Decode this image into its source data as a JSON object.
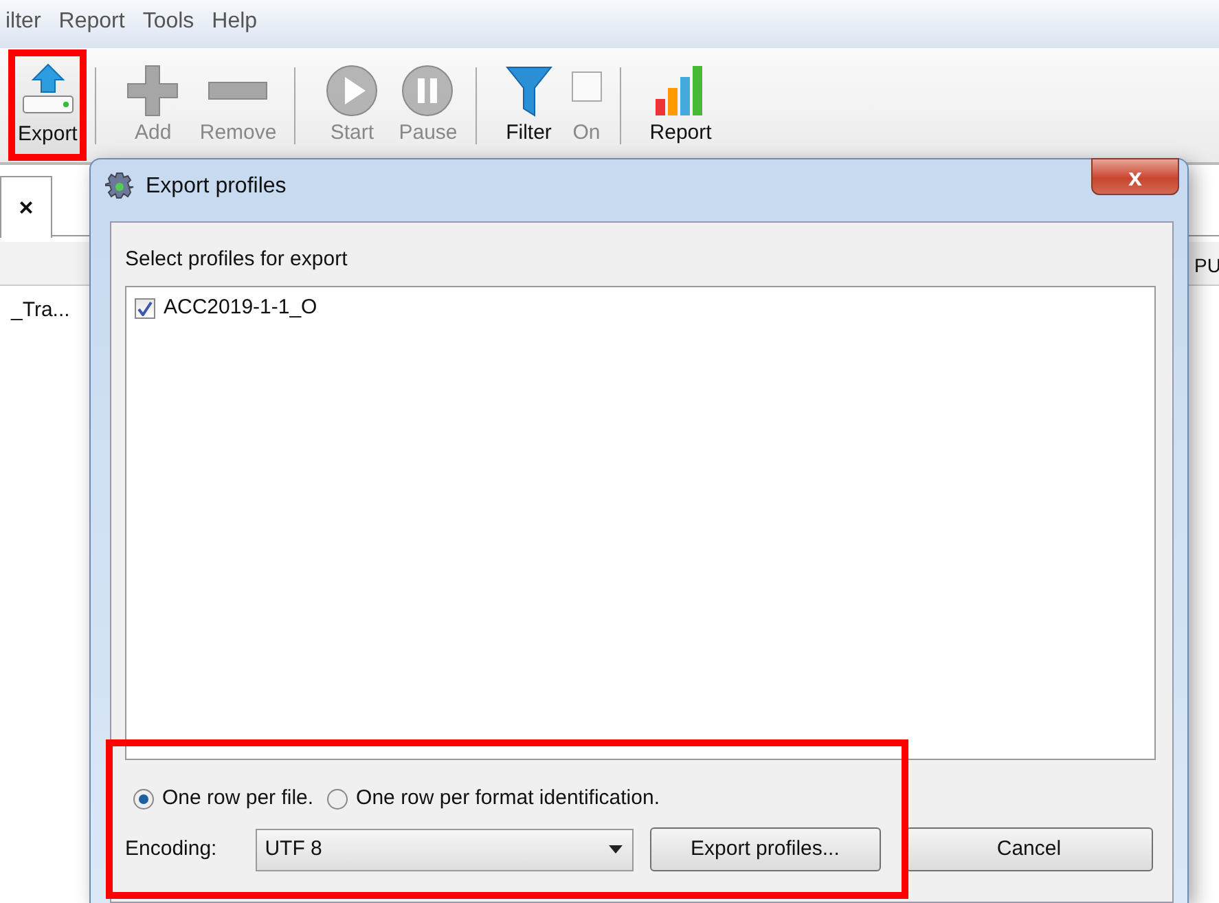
{
  "menu": [
    "ilter",
    "Report",
    "Tools",
    "Help"
  ],
  "toolbar": [
    {
      "label": "Export",
      "kind": "export",
      "disabled": false,
      "highlighted": true
    },
    {
      "kind": "separator"
    },
    {
      "label": "Add",
      "kind": "add",
      "disabled": true,
      "highlighted": false
    },
    {
      "label": "Remove",
      "kind": "remove",
      "disabled": true,
      "highlighted": false
    },
    {
      "kind": "separator"
    },
    {
      "label": "Start",
      "kind": "start",
      "disabled": true,
      "highlighted": false
    },
    {
      "label": "Pause",
      "kind": "pause",
      "disabled": true,
      "highlighted": false
    },
    {
      "kind": "separator"
    },
    {
      "label": "Filter",
      "kind": "filter",
      "disabled": false,
      "highlighted": false
    },
    {
      "label": "On",
      "kind": "check",
      "disabled": true,
      "checked": false,
      "highlighted": false
    },
    {
      "kind": "separator"
    },
    {
      "label": "Report",
      "kind": "report",
      "disabled": false,
      "highlighted": false
    }
  ],
  "background": {
    "tab_close": "×",
    "column_header": "PU",
    "row_cell": "_Tra..."
  },
  "dialog": {
    "title": "Export profiles",
    "close": "x",
    "prompt": "Select profiles for export",
    "profiles": [
      {
        "label": "ACC2019-1-1_O",
        "checked": true
      }
    ],
    "options_highlighted": true,
    "options": [
      {
        "label": "One row per file.",
        "selected": true
      },
      {
        "label": "One row per format identification.",
        "selected": false
      }
    ],
    "encoding_label": "Encoding:",
    "encoding_value": "UTF 8",
    "buttons": [
      "Export profiles...",
      "Cancel"
    ]
  }
}
